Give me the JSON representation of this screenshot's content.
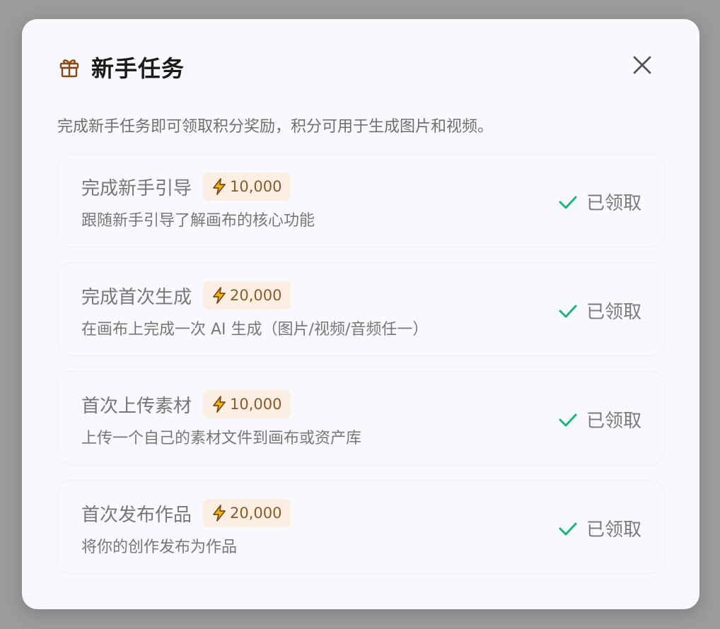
{
  "dialog": {
    "title": "新手任务",
    "subtitle": "完成新手任务即可领取积分奖励，积分可用于生成图片和视频。",
    "icons": {
      "header": "gift-icon",
      "close": "close-icon",
      "reward": "bolt-icon",
      "status": "check-icon"
    },
    "colors": {
      "gift": "#8a4b12",
      "bolt_stroke": "#7a4a1a",
      "bolt_fill": "#f5b800",
      "check": "#19b47a",
      "badge_bg": "#faefe2"
    }
  },
  "tasks": [
    {
      "title": "完成新手引导",
      "reward": "10,000",
      "description": "跟随新手引导了解画布的核心功能",
      "status": "已领取"
    },
    {
      "title": "完成首次生成",
      "reward": "20,000",
      "description": "在画布上完成一次 AI 生成（图片/视频/音频任一）",
      "status": "已领取"
    },
    {
      "title": "首次上传素材",
      "reward": "10,000",
      "description": "上传一个自己的素材文件到画布或资产库",
      "status": "已领取"
    },
    {
      "title": "首次发布作品",
      "reward": "20,000",
      "description": "将你的创作发布为作品",
      "status": "已领取"
    }
  ]
}
